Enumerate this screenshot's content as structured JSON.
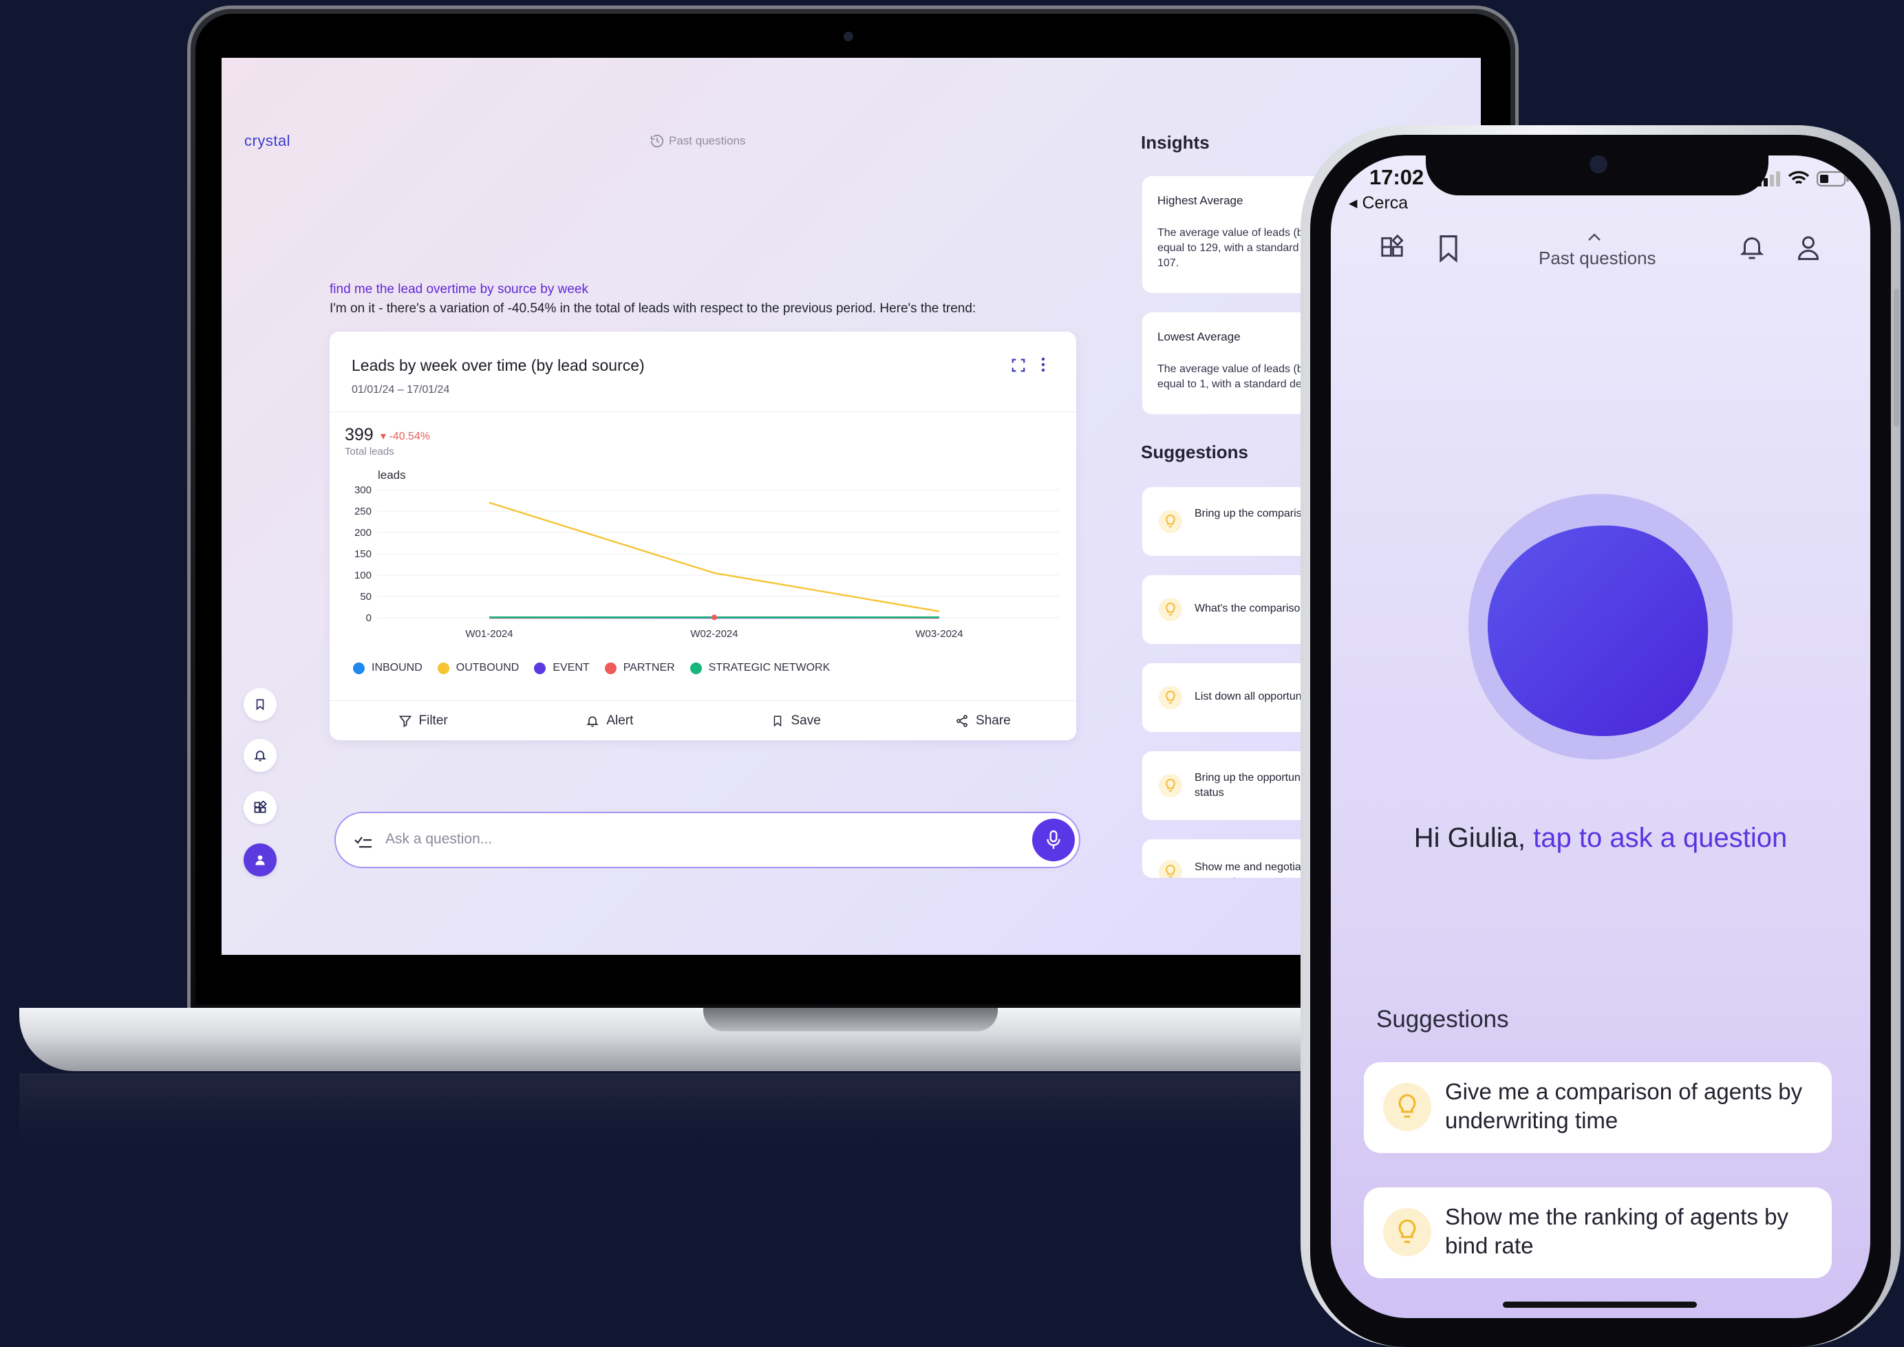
{
  "laptop": {
    "brand": "crystal",
    "past_questions": "Past questions",
    "query": "find me the lead overtime by source by week",
    "answer": "I'm on it - there's a variation of -40.54% in the total of leads with respect to the previous period. Here's the trend:",
    "card": {
      "title": "Leads by week over time (by lead source)",
      "date_range": "01/01/24 – 17/01/24",
      "total_value": "399",
      "delta": "▾ -40.54%",
      "total_label": "Total leads",
      "actions": [
        "Filter",
        "Alert",
        "Save",
        "Share"
      ]
    },
    "ask_placeholder": "Ask a question...",
    "insights": {
      "heading": "Insights",
      "cards": [
        {
          "title": "Highest Average",
          "body": "The average value of leads (by source) is equal to 129, with a standard deviation of 107."
        },
        {
          "title": "Lowest Average",
          "body": "The average value of leads (by source) is equal to 1, with a standard deviation of 0."
        }
      ]
    },
    "suggestions": {
      "heading": "Suggestions",
      "items": [
        "Bring up the comparison by stage",
        "What's the comparison",
        "List down all opportunities",
        "Bring up the opportunities by status",
        "Show me and negotiation conversion"
      ]
    }
  },
  "chart_data": {
    "type": "line",
    "title": "Leads by week over time (by lead source)",
    "ylabel": "leads",
    "xlabel": "",
    "categories": [
      "W01-2024",
      "W02-2024",
      "W03-2024"
    ],
    "ylim": [
      0,
      300
    ],
    "yticks": [
      0,
      50,
      100,
      150,
      200,
      250,
      300
    ],
    "series": [
      {
        "name": "INBOUND",
        "color": "#1e88f0",
        "values": [
          1,
          1,
          1
        ]
      },
      {
        "name": "OUTBOUND",
        "color": "#f5c533",
        "values": [
          270,
          105,
          15
        ]
      },
      {
        "name": "EVENT",
        "color": "#5b3be0",
        "values": [
          0,
          0,
          0
        ]
      },
      {
        "name": "PARTNER",
        "color": "#ef5a5a",
        "values": [
          0,
          1,
          0
        ]
      },
      {
        "name": "STRATEGIC NETWORK",
        "color": "#17b67c",
        "values": [
          1,
          1,
          1
        ]
      }
    ]
  },
  "phone": {
    "time": "17:02",
    "back_label": "◂ Cerca",
    "past_questions": "Past questions",
    "greeting_name": "Hi Giulia, ",
    "greeting_cta": "tap to ask a question",
    "suggestions_heading": "Suggestions",
    "suggestions": [
      "Give me a comparison of agents by underwriting time",
      "Show me the ranking of agents by bind rate"
    ]
  },
  "colors": {
    "accent": "#5b36e6",
    "background": "#111631"
  }
}
